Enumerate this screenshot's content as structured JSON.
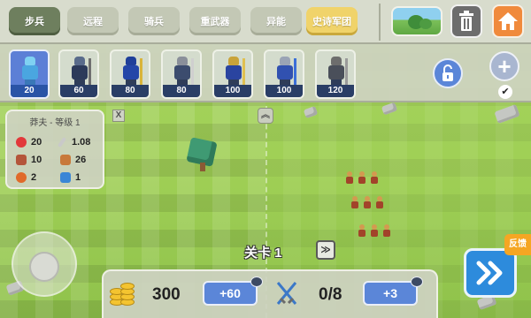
{
  "top_menu": {
    "tabs": [
      {
        "label": "步兵",
        "active": true
      },
      {
        "label": "远程",
        "active": false
      },
      {
        "label": "骑兵",
        "active": false
      },
      {
        "label": "重武器",
        "active": false
      },
      {
        "label": "异能",
        "active": false
      },
      {
        "label": "史诗军团",
        "active": false
      }
    ],
    "map_icon": "map-thumbnail-icon",
    "trash_icon": "trash-icon",
    "home_icon": "home-icon"
  },
  "unit_bar": {
    "units": [
      {
        "cost": "20",
        "selected": true
      },
      {
        "cost": "60",
        "selected": false
      },
      {
        "cost": "80",
        "selected": false
      },
      {
        "cost": "80",
        "selected": false
      },
      {
        "cost": "100",
        "selected": false
      },
      {
        "cost": "100",
        "selected": false
      },
      {
        "cost": "120",
        "selected": false
      }
    ],
    "lock_icon": "lock-icon",
    "add_label": "+",
    "check_label": "✔"
  },
  "stats_panel": {
    "title": "莽夫 - 等级 1",
    "close_label": "X",
    "health": "20",
    "attack_speed": "1.08",
    "attack": "10",
    "range": "26",
    "speed": "2",
    "armor": "1"
  },
  "collapse_label": "︽",
  "level": {
    "label": "关卡 1",
    "next_label": "≫"
  },
  "bottom_bar": {
    "gold": "300",
    "gold_bonus": "+60",
    "troops": "0/8",
    "troop_bonus": "+3"
  },
  "feedback_label": "反馈",
  "colors": {
    "accent_blue": "#5b86d8",
    "go_blue": "#2d8bdc",
    "home_orange": "#f08a3c",
    "grass": "#9ccf5a"
  }
}
